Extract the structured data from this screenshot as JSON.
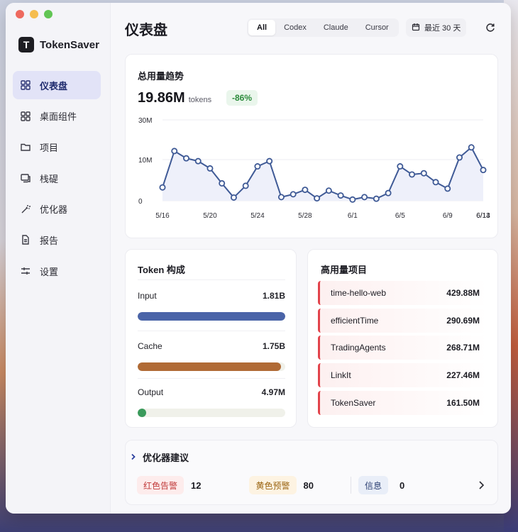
{
  "window": {
    "traffic_lights": [
      "close",
      "minimize",
      "zoom"
    ]
  },
  "sidebar": {
    "brand_logo": "T",
    "brand_name": "TokenSaver",
    "items": [
      {
        "label": "仪表盘",
        "icon": "grid-icon",
        "active": true
      },
      {
        "label": "桌面组件",
        "icon": "widgets-icon",
        "active": false
      },
      {
        "label": "项目",
        "icon": "folder-icon",
        "active": false
      },
      {
        "label": "栈碮",
        "icon": "monitor-icon",
        "active": false
      },
      {
        "label": "优化器",
        "icon": "magic-wand-icon",
        "active": false
      },
      {
        "label": "报告",
        "icon": "document-icon",
        "active": false
      },
      {
        "label": "设置",
        "icon": "sliders-icon",
        "active": false
      }
    ]
  },
  "header": {
    "title": "仪表盘",
    "filters": [
      "All",
      "Codex",
      "Claude",
      "Cursor"
    ],
    "active_filter": "All",
    "range_label": "最近 30 天"
  },
  "trend": {
    "title": "总用量趋势",
    "total_value": "19.86M",
    "total_unit": "tokens",
    "change": "-86%"
  },
  "chart_data": {
    "type": "line",
    "title": "总用量趋势",
    "x": [
      "5/16",
      "5/17",
      "5/18",
      "5/19",
      "5/20",
      "5/21",
      "5/22",
      "5/23",
      "5/24",
      "5/25",
      "5/26",
      "5/27",
      "5/28",
      "5/29",
      "5/30",
      "5/31",
      "6/1",
      "6/2",
      "6/3",
      "6/4",
      "6/5",
      "6/6",
      "6/7",
      "6/8",
      "6/9",
      "6/10",
      "6/11",
      "6/12",
      "6/13",
      "6/14"
    ],
    "series": [
      {
        "values": [
          3.3,
          12.3,
          10.5,
          9.8,
          8.0,
          4.3,
          0.8,
          3.7,
          8.5,
          9.8,
          0.9,
          1.6,
          2.7,
          0.6,
          2.5,
          1.3,
          0.3,
          0.9,
          0.5,
          1.9,
          8.5,
          6.5,
          6.8,
          4.6,
          3.0,
          10.7,
          13.2,
          7.6
        ]
      }
    ],
    "x_ticks": [
      "5/16",
      "5/20",
      "5/24",
      "5/28",
      "6/1",
      "6/5",
      "6/9",
      "6/13",
      "6/14"
    ],
    "y_ticks": [
      "0",
      "10M",
      "30M"
    ],
    "y_tick_values": [
      0,
      10,
      30
    ],
    "ylim": [
      0,
      20
    ],
    "grid": true,
    "colors": {
      "line": "#3f5a96",
      "fill": "#eef0fa",
      "point": "#ffffff"
    }
  },
  "composition": {
    "title": "Token 构成",
    "items": [
      {
        "label": "Input",
        "value": "1.81B",
        "fraction": 1.0,
        "color": "#4a64a8"
      },
      {
        "label": "Cache",
        "value": "1.75B",
        "fraction": 0.97,
        "color": "#b06a35"
      },
      {
        "label": "Output",
        "value": "4.97M",
        "fraction": 0.06,
        "color": "#3a9a5b"
      }
    ]
  },
  "projects": {
    "title": "高用量项目",
    "items": [
      {
        "name": "time-hello-web",
        "value": "429.88M"
      },
      {
        "name": "efficientTime",
        "value": "290.69M"
      },
      {
        "name": "TradingAgents",
        "value": "268.71M"
      },
      {
        "name": "LinkIt",
        "value": "227.46M"
      },
      {
        "name": "TokenSaver",
        "value": "161.50M"
      }
    ]
  },
  "advice": {
    "title": "优化器建议",
    "red_label": "红色告警",
    "red_count": "12",
    "yellow_label": "黄色预警",
    "yellow_count": "80",
    "info_label": "信息",
    "info_count": "0"
  }
}
